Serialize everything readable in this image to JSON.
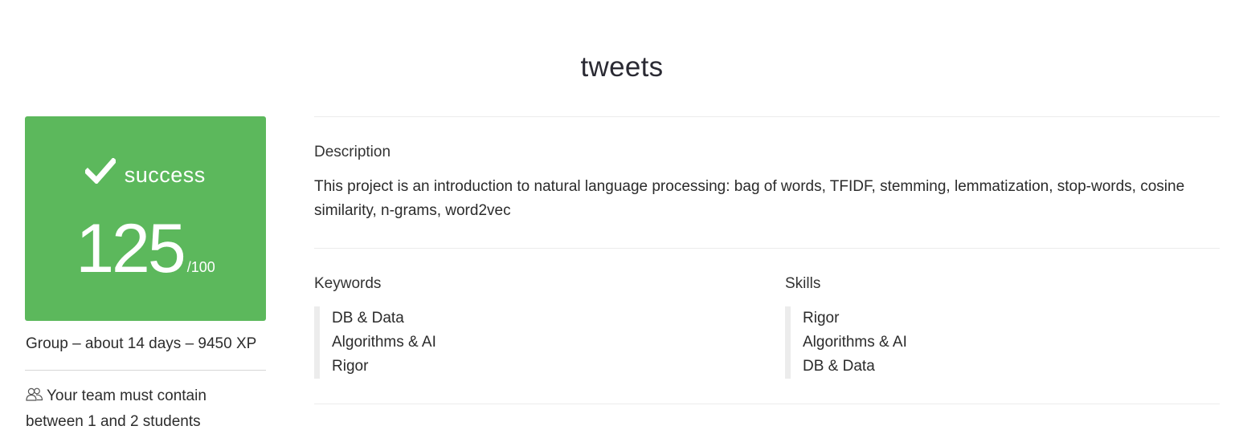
{
  "project": {
    "title": "tweets"
  },
  "score_card": {
    "status_icon": "check-icon",
    "status": "success",
    "score": "125",
    "max": "/100",
    "color": "#5cb85c"
  },
  "meta": {
    "line": "Group – about 14 days – 9450 XP",
    "team_icon": "users-icon",
    "team_note": "Your team must contain between 1 and 2 students"
  },
  "description": {
    "heading": "Description",
    "text": "This project is an introduction to natural language processing: bag of words, TFIDF, stemming, lemmatization, stop-words, cosine similarity, n-grams, word2vec"
  },
  "keywords": {
    "heading": "Keywords",
    "items": [
      "DB & Data",
      "Algorithms & AI",
      "Rigor"
    ]
  },
  "skills": {
    "heading": "Skills",
    "items": [
      "Rigor",
      "Algorithms & AI",
      "DB & Data"
    ]
  }
}
